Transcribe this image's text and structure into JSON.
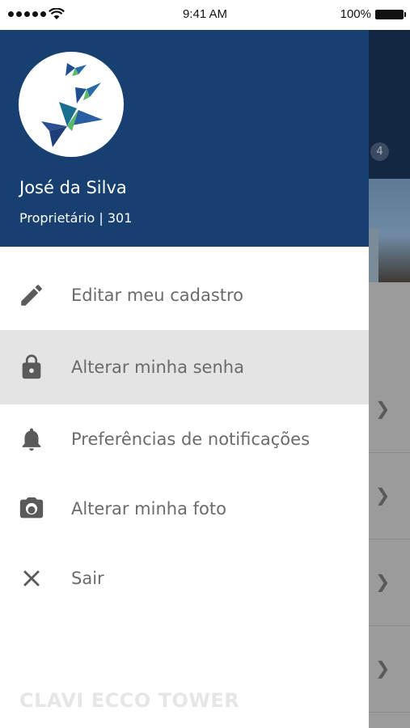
{
  "status_bar": {
    "time": "9:41 AM",
    "battery": "100%"
  },
  "background_page": {
    "badge": "4"
  },
  "drawer": {
    "user": {
      "name": "José da Silva",
      "role": "Proprietário | 301"
    },
    "menu": [
      {
        "label": "Editar meu cadastro",
        "icon": "pencil-icon",
        "active": false
      },
      {
        "label": "Alterar minha senha",
        "icon": "lock-icon",
        "active": true
      },
      {
        "label": "Preferências de notificações",
        "icon": "bell-icon",
        "active": false
      },
      {
        "label": "Alterar minha foto",
        "icon": "camera-icon",
        "active": false
      },
      {
        "label": "Sair",
        "icon": "close-icon",
        "active": false
      }
    ],
    "footer_brand": "CLAVI ECCO TOWER"
  },
  "colors": {
    "header": "#173f70",
    "active_item": "#e4e4e4",
    "icon": "#5a5a5a",
    "label": "#6b6b6b"
  }
}
